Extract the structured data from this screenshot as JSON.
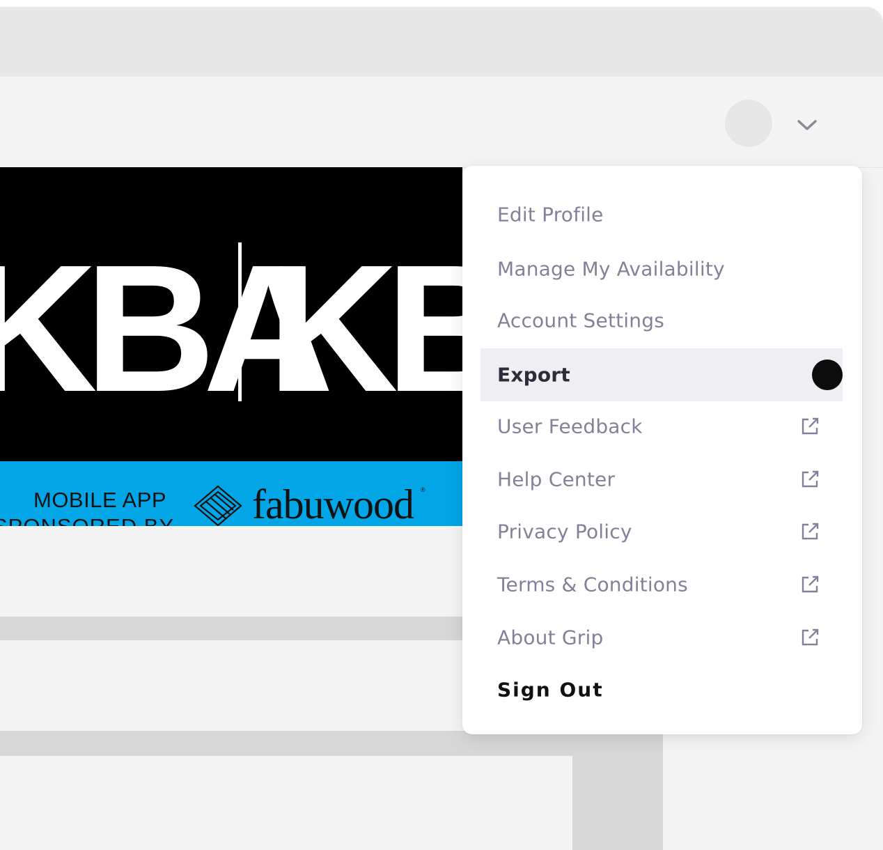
{
  "header": {
    "avatar": "user-avatar",
    "dropdown_icon": "chevron-down-icon"
  },
  "banner": {
    "logo_left": "KBA",
    "logo_right": "KB",
    "sponsor_line1": "MOBILE APP",
    "sponsor_line2": "SPONSORED BY",
    "sponsor_brand": "fabuwood",
    "sponsor_reg": "®"
  },
  "menu": {
    "items": [
      {
        "label": "Edit Profile"
      },
      {
        "label": "Manage My Availability"
      },
      {
        "label": "Account Settings"
      },
      {
        "label": "Export",
        "selected": true
      },
      {
        "label": "User Feedback",
        "icon": "external-link-icon"
      },
      {
        "label": "Help Center",
        "icon": "external-link-icon"
      },
      {
        "label": "Privacy Policy",
        "icon": "external-link-icon"
      },
      {
        "label": "Terms & Conditions",
        "icon": "external-link-icon"
      },
      {
        "label": "About Grip",
        "icon": "external-link-icon"
      },
      {
        "label": "Sign Out"
      }
    ]
  },
  "colors": {
    "menu_text": "#858099",
    "selected_bg": "#efeef3",
    "sponsor_blue": "#02a6e6"
  }
}
